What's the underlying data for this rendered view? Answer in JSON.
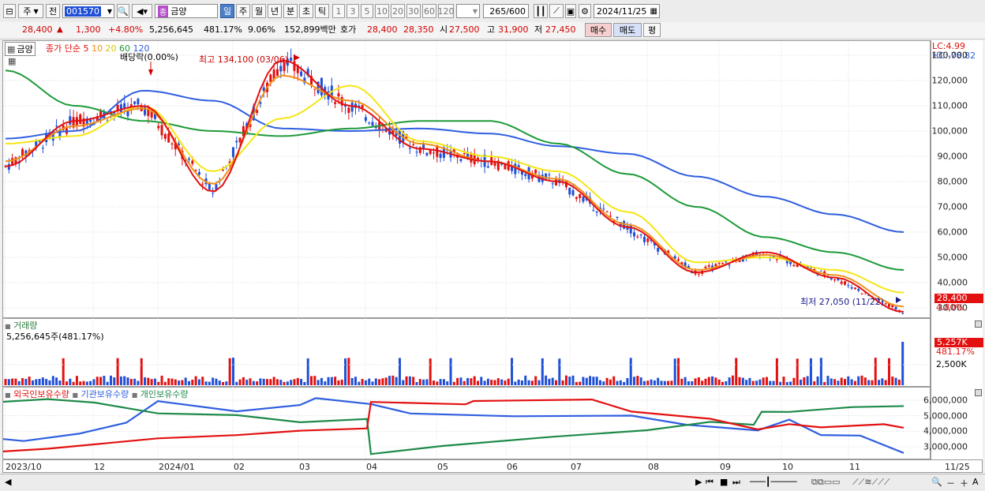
{
  "toolbar": {
    "period_label": "주",
    "prev_label": "전",
    "code": "001570",
    "stock_name": "금양",
    "badge": "종",
    "periods": [
      "일",
      "주",
      "월",
      "년",
      "분",
      "초",
      "틱"
    ],
    "intervals": [
      "1",
      "3",
      "5",
      "10",
      "20",
      "30",
      "60",
      "120"
    ],
    "count": "265",
    "count_total": "/600",
    "date": "2024/11/25"
  },
  "price_bar": {
    "price": "28,400",
    "change": "1,300",
    "change_pct": "+4.80%",
    "volume": "5,256,645",
    "vol_pct": "481.17%",
    "turnover": "9.06%",
    "amount": "152,899백만",
    "quote_label": "호가",
    "ask": "28,400",
    "bid": "28,350",
    "open_label": "시",
    "open": "27,500",
    "high_label": "고",
    "high": "31,900",
    "low_label": "저",
    "low": "27,450",
    "buy_label": "매수",
    "sell_label": "매도",
    "eval_label": "평"
  },
  "price_chart": {
    "name_tag": "금양",
    "ma_prefix": "종가 단순",
    "ma_periods": [
      "5",
      "10",
      "20",
      "60",
      "120"
    ],
    "dividend_label": "배당락(0.00%)",
    "high_note": "최고 134,100 (03/06)",
    "low_note": "최저 27,050 (11/22)",
    "lc_label": "LC:4.99",
    "hc_label": "HC:-78.82",
    "current_tag": "28,400",
    "current_pct": "4.80%",
    "y_ticks": [
      "130,000",
      "120,000",
      "110,000",
      "100,000",
      "90,000",
      "80,000",
      "70,000",
      "60,000",
      "50,000",
      "40,000",
      "30,000"
    ]
  },
  "volume_chart": {
    "title": "거래량",
    "value_text": "5,256,645주(481.17%)",
    "tag": "5,257K",
    "tag_pct": "481.17%",
    "tick": "2,500K"
  },
  "holding_chart": {
    "series": [
      "외국인보유수량",
      "기관보유수량",
      "개인보유수량"
    ],
    "y_ticks": [
      "6,000,000",
      "5,000,000",
      "4,000,000",
      "3,000,000"
    ]
  },
  "x_axis": {
    "labels": [
      "2023/10",
      "12",
      "2024/01",
      "02",
      "03",
      "04",
      "05",
      "06",
      "07",
      "08",
      "09",
      "10",
      "11"
    ],
    "right_label": "11/25"
  },
  "colors": {
    "up": "#e31010",
    "down": "#1f4fd6",
    "ma5": "#e31010",
    "ma10": "#f0901a",
    "ma20": "#f5e614",
    "ma60": "#1e9a3a",
    "ma120": "#2f5ee0",
    "foreign": "#2f5ee0",
    "institution": "#1e8a4a",
    "individual": "#e31010"
  },
  "chart_data": {
    "type": "line",
    "x": [
      "2023/10",
      "12",
      "2024/01",
      "02",
      "03",
      "04",
      "05",
      "06",
      "07",
      "08",
      "09",
      "10",
      "11",
      "11/25"
    ],
    "series": [
      {
        "name": "5",
        "values": [
          86000,
          104000,
          110000,
          76000,
          128000,
          110000,
          93000,
          88000,
          80000,
          62000,
          44000,
          52000,
          42000,
          28400
        ]
      },
      {
        "name": "10",
        "values": [
          88000,
          102000,
          109000,
          79000,
          122000,
          112000,
          95000,
          88000,
          81000,
          63000,
          45000,
          51000,
          43000,
          30500
        ]
      },
      {
        "name": "20",
        "values": [
          95000,
          98000,
          110000,
          84000,
          105000,
          118000,
          96000,
          90000,
          84000,
          68000,
          48000,
          50000,
          45000,
          36000
        ]
      },
      {
        "name": "60",
        "values": [
          124000,
          110000,
          104000,
          100000,
          98000,
          101000,
          104000,
          104000,
          95000,
          83000,
          70000,
          58000,
          52000,
          45000
        ]
      },
      {
        "name": "120",
        "values": [
          97000,
          100000,
          116000,
          112000,
          101000,
          100000,
          101000,
          99000,
          94000,
          91000,
          82000,
          74000,
          67000,
          60000
        ]
      }
    ],
    "ylim": [
      25000,
      135000
    ],
    "volume_last": 5256645
  }
}
